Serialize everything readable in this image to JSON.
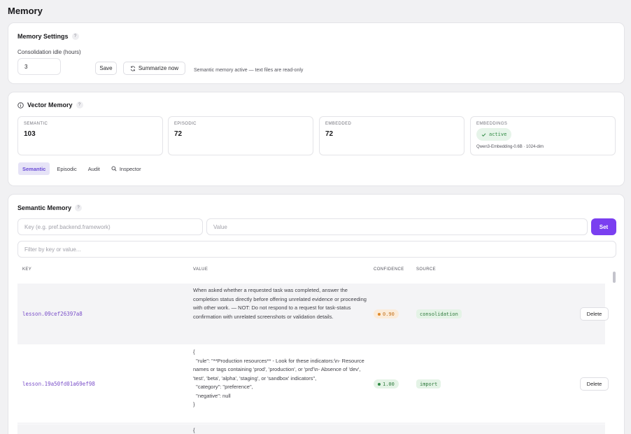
{
  "page": {
    "title": "Memory"
  },
  "settings": {
    "title": "Memory Settings",
    "idle_label": "Consolidation idle (hours)",
    "idle_value": "3",
    "save_label": "Save",
    "summarize_label": "Summarize now",
    "status_note": "Semantic memory active — text files are read-only"
  },
  "vector": {
    "title": "Vector Memory",
    "stats": [
      {
        "caption": "SEMANTIC",
        "value": "103"
      },
      {
        "caption": "EPISODIC",
        "value": "72"
      },
      {
        "caption": "EMBEDDED",
        "value": "72"
      }
    ],
    "embeddings": {
      "caption": "EMBEDDINGS",
      "status": "active",
      "model": "Qwen3-Embedding-0.6B · 1024-dim"
    },
    "tabs": [
      "Semantic",
      "Episodic",
      "Audit",
      "Inspector"
    ]
  },
  "semantic": {
    "title": "Semantic Memory",
    "key_placeholder": "Key (e.g. pref.backend.framework)",
    "value_placeholder": "Value",
    "set_label": "Set",
    "filter_placeholder": "Filter by key or value...",
    "columns": {
      "key": "KEY",
      "value": "VALUE",
      "confidence": "CONFIDENCE",
      "source": "SOURCE"
    },
    "rows": [
      {
        "key": "lesson.09cef26397a8",
        "value": "When asked whether a requested task was completed, answer the completion status directly before offering unrelated evidence or proceeding with other work. — NOT: Do not respond to a request for task-status confirmation with unrelated screenshots or validation details.",
        "confidence": "0.90",
        "source": "consolidation",
        "delete_label": "Delete"
      },
      {
        "key": "lesson.19a50fd01a69ef98",
        "value": "{\n  \"rule\": \"**Production resources** - Look for these indicators:\\n- Resource names or tags containing 'prod', 'production', or 'prd'\\n- Absence of 'dev', 'test', 'beta', 'alpha', 'staging', or 'sandbox' indicators\",\n  \"category\": \"preference\",\n  \"negative\": null\n}",
        "confidence": "1.00",
        "source": "import",
        "delete_label": "Delete"
      },
      {
        "value": "{"
      }
    ]
  },
  "colors": {
    "accent": "#7a3ff0",
    "active_green": "#2f8a43",
    "confidence_orange": "#c2701a"
  }
}
